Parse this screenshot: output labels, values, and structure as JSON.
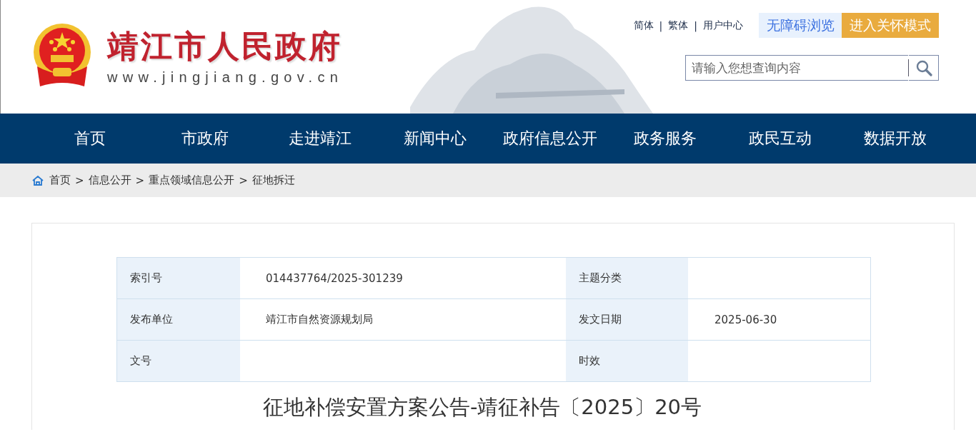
{
  "header": {
    "site_title": "靖江市人民政府",
    "site_url": "www.jingjiang.gov.cn",
    "top_links": [
      "简体",
      "繁体",
      "用户中心"
    ],
    "link_separator": "|",
    "accessibility_button": "无障碍浏览",
    "care_mode_button": "进入关怀模式",
    "search": {
      "placeholder": "请输入您想查询内容"
    }
  },
  "nav": [
    {
      "label": "首页"
    },
    {
      "label": "市政府"
    },
    {
      "label": "走进靖江"
    },
    {
      "label": "新闻中心"
    },
    {
      "label": "政府信息公开"
    },
    {
      "label": "政务服务"
    },
    {
      "label": "政民互动"
    },
    {
      "label": "数据开放"
    }
  ],
  "breadcrumb": {
    "items": [
      "首页",
      "信息公开",
      "重点领域信息公开",
      "征地拆迁"
    ],
    "separator": ">"
  },
  "meta_table": {
    "rows": [
      {
        "label_1": "索引号",
        "value_1": "014437764/2025-301239",
        "label_2": "主题分类"
      },
      {
        "label_1": "发布单位",
        "value_1": "靖江市自然资源规划局",
        "label_2": "发文日期",
        "value_2": "2025-06-30"
      },
      {
        "label_1": "文号",
        "label_2": "时效"
      }
    ]
  },
  "article_title": "征地补偿安置方案公告-靖征补告〔2025〕20号"
}
